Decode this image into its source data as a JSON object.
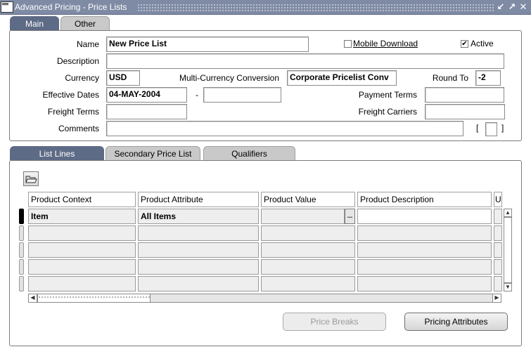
{
  "window": {
    "title": "Advanced Pricing - Price Lists",
    "icon": "oracle-forms-icon",
    "controls": {
      "minimize": "↙",
      "maximize": "↗",
      "close": "✕"
    }
  },
  "top_tabs": [
    {
      "label": "Main",
      "active": true
    },
    {
      "label": "Other",
      "active": false
    }
  ],
  "header": {
    "name_label": "Name",
    "name_value": "New Price List",
    "mobile_download_label": "Mobile Download",
    "mobile_download_checked": false,
    "active_label": "Active",
    "active_checked": true,
    "active_mark": "✔",
    "description_label": "Description",
    "description_value": "",
    "currency_label": "Currency",
    "currency_value": "USD",
    "multi_currency_label": "Multi-Currency Conversion",
    "multi_currency_value": "Corporate Pricelist Conv",
    "round_to_label": "Round To",
    "round_to_value": "-2",
    "effective_dates_label": "Effective Dates",
    "effective_from": "04-MAY-2004",
    "date_separator": "-",
    "effective_to": "",
    "payment_terms_label": "Payment Terms",
    "payment_terms_value": "",
    "freight_terms_label": "Freight Terms",
    "freight_terms_value": "",
    "freight_carriers_label": "Freight Carriers",
    "freight_carriers_value": "",
    "comments_label": "Comments",
    "comments_value": "",
    "dff_open": "[",
    "dff_close": "]"
  },
  "lower_tabs": [
    {
      "label": "List Lines",
      "active": true
    },
    {
      "label": "Secondary Price List",
      "active": false
    },
    {
      "label": "Qualifiers",
      "active": false
    }
  ],
  "grid": {
    "toolbar_icon": "folder-icon",
    "columns": [
      "Product Context",
      "Product Attribute",
      "Product Value",
      "Product Description",
      "U"
    ],
    "rows": [
      [
        "Item",
        "All Items",
        "",
        ""
      ],
      [
        "",
        "",
        "",
        ""
      ],
      [
        "",
        "",
        "",
        ""
      ],
      [
        "",
        "",
        "",
        ""
      ],
      [
        "",
        "",
        "",
        ""
      ]
    ],
    "lov_button": "..."
  },
  "buttons": {
    "price_breaks": "Price Breaks",
    "price_breaks_enabled": false,
    "pricing_attributes": "Pricing Attributes"
  },
  "colors": {
    "titlebar": "#7f8ba5",
    "active_tab": "#5e6b86",
    "inactive_tab": "#c9c9c9"
  }
}
